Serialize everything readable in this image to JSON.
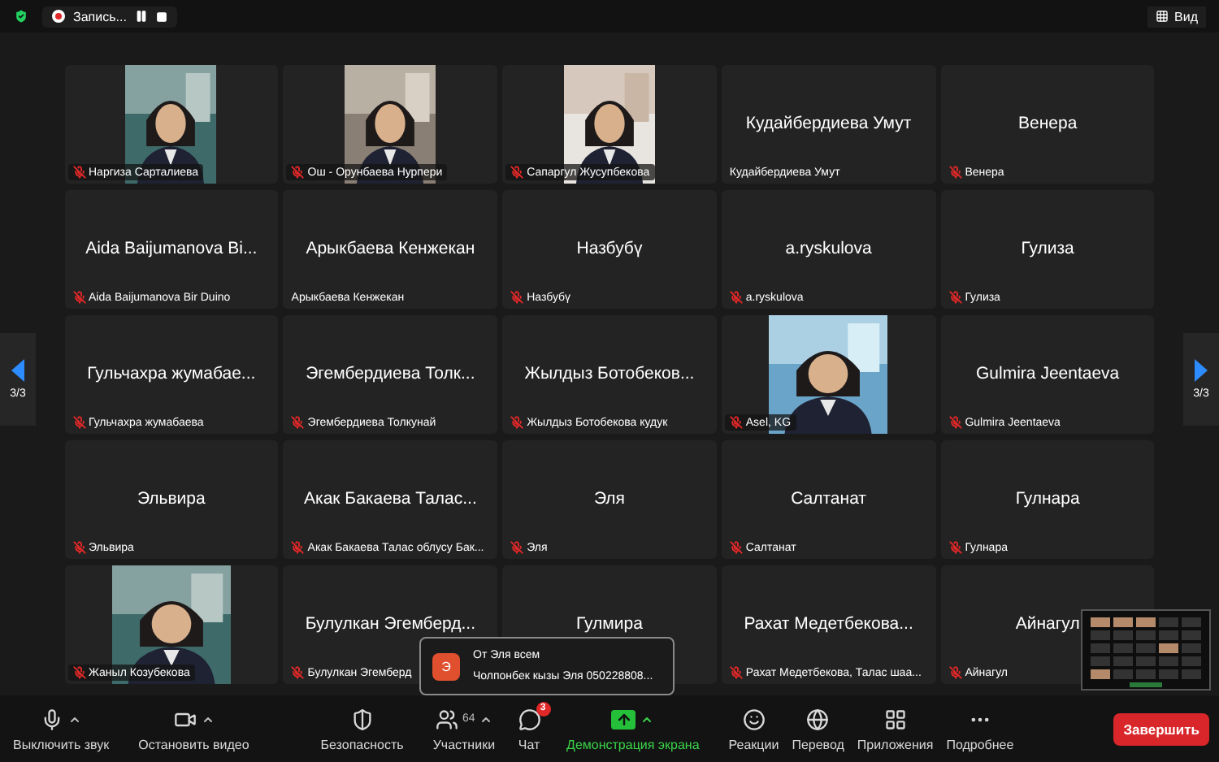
{
  "top_bar": {
    "recording_label": "Запись...",
    "view_label": "Вид"
  },
  "pager": {
    "left": "3/3",
    "right": "3/3"
  },
  "tiles": [
    {
      "kind": "video",
      "name": "Наргиза Сарталиева",
      "muted": true
    },
    {
      "kind": "video",
      "name": "Ош - Орунбаева Нурпери",
      "muted": true
    },
    {
      "kind": "video",
      "name": "Сапаргул Жусупбекова",
      "muted": true
    },
    {
      "kind": "name",
      "title": "Кудайбердиева Умут",
      "name": "Кудайбердиева Умут",
      "muted": false
    },
    {
      "kind": "name",
      "title": "Венера",
      "name": "Венера",
      "muted": true
    },
    {
      "kind": "name",
      "title": "Aida Baijumanova  Bi...",
      "name": "Aida Baijumanova  Bir Duino",
      "muted": true
    },
    {
      "kind": "name",
      "title": "Арыкбаева Кенжекан",
      "name": "Арыкбаева Кенжекан",
      "muted": false
    },
    {
      "kind": "name",
      "title": "Назбубү",
      "name": "Назбубү",
      "muted": true
    },
    {
      "kind": "name",
      "title": "a.ryskulova",
      "name": "a.ryskulova",
      "muted": true
    },
    {
      "kind": "name",
      "title": "Гулиза",
      "name": "Гулиза",
      "muted": true
    },
    {
      "kind": "name",
      "title": "Гульчахра жумабае...",
      "name": "Гульчахра жумабаева",
      "muted": true
    },
    {
      "kind": "name",
      "title": "Эгембердиева Толк...",
      "name": "Эгембердиева Толкунай",
      "muted": true
    },
    {
      "kind": "name",
      "title": "Жылдыз Ботобеков...",
      "name": "Жылдыз Ботобекова кудук",
      "muted": true
    },
    {
      "kind": "video",
      "name": "Asel, KG",
      "muted": true
    },
    {
      "kind": "name",
      "title": "Gulmira Jeentaeva",
      "name": "Gulmira Jeentaeva",
      "muted": true
    },
    {
      "kind": "name",
      "title": "Эльвира",
      "name": "Эльвира",
      "muted": true
    },
    {
      "kind": "name",
      "title": "Акак Бакаева Талас...",
      "name": "Акак Бакаева Талас облусу Бак...",
      "muted": true
    },
    {
      "kind": "name",
      "title": "Эля",
      "name": "Эля",
      "muted": true
    },
    {
      "kind": "name",
      "title": "Салтанат",
      "name": "Салтанат",
      "muted": true
    },
    {
      "kind": "name",
      "title": "Гулнара",
      "name": "Гулнара",
      "muted": true
    },
    {
      "kind": "video",
      "name": "Жаныл Козубекова",
      "muted": true
    },
    {
      "kind": "name",
      "title": "Булулкан Эгемберд...",
      "name": "Булулкан Эгемберд",
      "muted": true
    },
    {
      "kind": "name",
      "title": "Гулмира"
    },
    {
      "kind": "name",
      "title": "Рахат Медетбекова...",
      "name": "Рахат Медетбекова, Талас шаа...",
      "muted": true
    },
    {
      "kind": "name",
      "title": "Айнагул",
      "name": "Айнагул",
      "muted": true
    }
  ],
  "chat_popup": {
    "avatar": "Э",
    "title": "От Эля всем",
    "message": "Чолпонбек кызы Эля 050228808..."
  },
  "toolbar": [
    {
      "kind": "mic",
      "label": "Выключить звук",
      "caret": true,
      "highlighted": false
    },
    {
      "kind": "video",
      "label": "Остановить видео",
      "caret": true,
      "highlighted": false
    },
    {
      "kind": "security",
      "label": "Безопасность",
      "caret": false,
      "highlighted": false
    },
    {
      "kind": "participants",
      "label": "Участники",
      "count": "64",
      "caret": true,
      "highlighted": false
    },
    {
      "kind": "chat",
      "label": "Чат",
      "badge": "3",
      "caret": false,
      "highlighted": false
    },
    {
      "kind": "share",
      "label": "Демонстрация экрана",
      "caret": true,
      "highlighted": true
    },
    {
      "kind": "reactions",
      "label": "Реакции",
      "caret": false,
      "highlighted": false
    },
    {
      "kind": "translate",
      "label": "Перевод",
      "caret": false,
      "highlighted": false
    },
    {
      "kind": "apps",
      "label": "Приложения",
      "caret": false,
      "highlighted": false
    },
    {
      "kind": "more",
      "label": "Подробнее",
      "caret": false,
      "highlighted": false
    }
  ],
  "end_button": "Завершить"
}
